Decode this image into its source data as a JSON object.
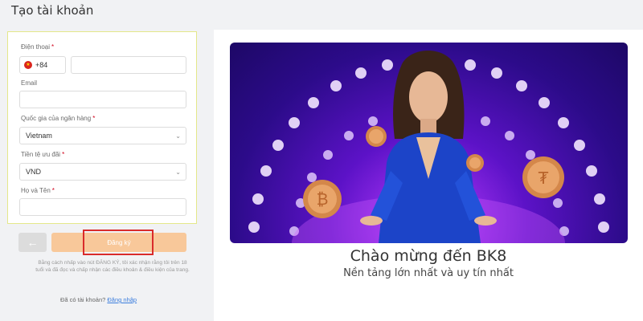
{
  "page": {
    "title": "Tạo tài khoản"
  },
  "form": {
    "phone": {
      "label": "Điện thoại",
      "required_mark": "*",
      "country_code": "+84",
      "value": ""
    },
    "email": {
      "label": "Email",
      "value": ""
    },
    "bank_country": {
      "label": "Quốc gia của ngân hàng",
      "required_mark": "*",
      "selected": "Vietnam"
    },
    "currency": {
      "label": "Tiền tệ ưu đãi",
      "required_mark": "*",
      "selected": "VND"
    },
    "full_name": {
      "label": "Họ và Tên",
      "required_mark": "*",
      "value": ""
    }
  },
  "actions": {
    "back_icon": "arrow-left-icon",
    "back_glyph": "←",
    "register_label": "Đăng ký"
  },
  "consent_text": "Bằng cách nhấp vào nút ĐĂNG KÝ, tôi xác nhận rằng tôi trên 18 tuổi và đã đọc và chấp nhận các điều khoản & điều kiện của trang.",
  "login_prompt": {
    "text": "Đã có tài khoản?",
    "link": "Đăng nhập"
  },
  "promo": {
    "welcome": "Chào mừng đến BK8",
    "tagline": "Nền tảng lớn nhất và uy tín nhất"
  },
  "colors": {
    "page_bg": "#f1f2f4",
    "form_border": "#e4e88a",
    "register_button": "#f8c89a",
    "highlight": "#d92b2b",
    "link": "#3b7ddd",
    "banner_purple": "#5c12c7"
  }
}
